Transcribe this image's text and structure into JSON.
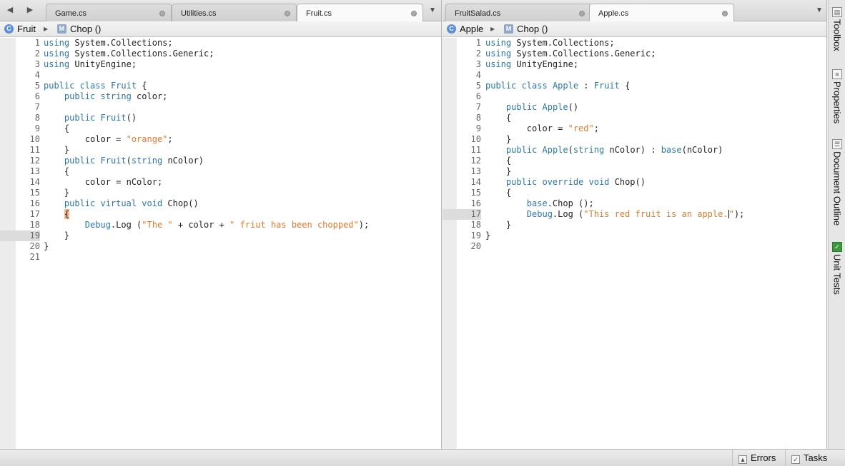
{
  "left": {
    "tabs": [
      {
        "label": "Game.cs",
        "active": false
      },
      {
        "label": "Utilities.cs",
        "active": false
      },
      {
        "label": "Fruit.cs",
        "active": true
      }
    ],
    "path": {
      "class_name": "Fruit",
      "method_name": "Chop ()"
    },
    "current_line": 19,
    "lines": [
      {
        "n": "1",
        "tokens": [
          {
            "t": "using",
            "c": "kw"
          },
          {
            "t": " System.Collections;"
          }
        ]
      },
      {
        "n": "2",
        "tokens": [
          {
            "t": "using",
            "c": "kw"
          },
          {
            "t": " System.Collections.Generic;"
          }
        ]
      },
      {
        "n": "3",
        "tokens": [
          {
            "t": "using",
            "c": "kw"
          },
          {
            "t": " UnityEngine;"
          }
        ]
      },
      {
        "n": "4",
        "tokens": []
      },
      {
        "n": "5",
        "tokens": [
          {
            "t": "public class",
            "c": "kw"
          },
          {
            "t": " "
          },
          {
            "t": "Fruit",
            "c": "ty"
          },
          {
            "t": " {"
          }
        ]
      },
      {
        "n": "6",
        "tokens": [
          {
            "t": "    "
          },
          {
            "t": "public string",
            "c": "kw"
          },
          {
            "t": " color;"
          }
        ]
      },
      {
        "n": "7",
        "tokens": []
      },
      {
        "n": "8",
        "tokens": [
          {
            "t": "    "
          },
          {
            "t": "public",
            "c": "kw"
          },
          {
            "t": " "
          },
          {
            "t": "Fruit",
            "c": "ty"
          },
          {
            "t": "()"
          }
        ]
      },
      {
        "n": "9",
        "tokens": [
          {
            "t": "    {"
          }
        ]
      },
      {
        "n": "10",
        "tokens": [
          {
            "t": "        color = "
          },
          {
            "t": "\"orange\"",
            "c": "str"
          },
          {
            "t": ";"
          }
        ]
      },
      {
        "n": "11",
        "tokens": [
          {
            "t": "    }"
          }
        ]
      },
      {
        "n": "12",
        "tokens": [
          {
            "t": "    "
          },
          {
            "t": "public",
            "c": "kw"
          },
          {
            "t": " "
          },
          {
            "t": "Fruit",
            "c": "ty"
          },
          {
            "t": "("
          },
          {
            "t": "string",
            "c": "kw"
          },
          {
            "t": " nColor)"
          }
        ]
      },
      {
        "n": "13",
        "tokens": [
          {
            "t": "    {"
          }
        ]
      },
      {
        "n": "14",
        "tokens": [
          {
            "t": "        color = nColor;"
          }
        ]
      },
      {
        "n": "15",
        "tokens": [
          {
            "t": "    }"
          }
        ]
      },
      {
        "n": "16",
        "tokens": [
          {
            "t": "    "
          },
          {
            "t": "public virtual void",
            "c": "kw"
          },
          {
            "t": " Chop()"
          }
        ]
      },
      {
        "n": "17",
        "tokens": [
          {
            "t": "    "
          },
          {
            "t": "{",
            "c": "bh"
          }
        ]
      },
      {
        "n": "18",
        "tokens": [
          {
            "t": "        "
          },
          {
            "t": "Debug",
            "c": "ty"
          },
          {
            "t": ".Log ("
          },
          {
            "t": "\"The \"",
            "c": "str"
          },
          {
            "t": " + color + "
          },
          {
            "t": "\" friut has been chopped\"",
            "c": "str"
          },
          {
            "t": ");"
          }
        ]
      },
      {
        "n": "19",
        "tokens": [
          {
            "t": "    }"
          }
        ]
      },
      {
        "n": "20",
        "tokens": [
          {
            "t": "}"
          }
        ]
      },
      {
        "n": "21",
        "tokens": []
      }
    ]
  },
  "right": {
    "tabs": [
      {
        "label": "FruitSalad.cs",
        "active": false
      },
      {
        "label": "Apple.cs",
        "active": true
      }
    ],
    "path": {
      "class_name": "Apple",
      "method_name": "Chop ()"
    },
    "current_line": 17,
    "lines": [
      {
        "n": "1",
        "tokens": [
          {
            "t": "using",
            "c": "kw"
          },
          {
            "t": " System.Collections;"
          }
        ]
      },
      {
        "n": "2",
        "tokens": [
          {
            "t": "using",
            "c": "kw"
          },
          {
            "t": " System.Collections.Generic;"
          }
        ]
      },
      {
        "n": "3",
        "tokens": [
          {
            "t": "using",
            "c": "kw"
          },
          {
            "t": " UnityEngine;"
          }
        ]
      },
      {
        "n": "4",
        "tokens": []
      },
      {
        "n": "5",
        "tokens": [
          {
            "t": "public class",
            "c": "kw"
          },
          {
            "t": " "
          },
          {
            "t": "Apple",
            "c": "ty"
          },
          {
            "t": " : "
          },
          {
            "t": "Fruit",
            "c": "ty"
          },
          {
            "t": " {"
          }
        ]
      },
      {
        "n": "6",
        "tokens": []
      },
      {
        "n": "7",
        "tokens": [
          {
            "t": "    "
          },
          {
            "t": "public",
            "c": "kw"
          },
          {
            "t": " "
          },
          {
            "t": "Apple",
            "c": "ty"
          },
          {
            "t": "()"
          }
        ]
      },
      {
        "n": "8",
        "tokens": [
          {
            "t": "    {"
          }
        ]
      },
      {
        "n": "9",
        "tokens": [
          {
            "t": "        color = "
          },
          {
            "t": "\"red\"",
            "c": "str"
          },
          {
            "t": ";"
          }
        ]
      },
      {
        "n": "10",
        "tokens": [
          {
            "t": "    }"
          }
        ]
      },
      {
        "n": "11",
        "tokens": [
          {
            "t": "    "
          },
          {
            "t": "public",
            "c": "kw"
          },
          {
            "t": " "
          },
          {
            "t": "Apple",
            "c": "ty"
          },
          {
            "t": "("
          },
          {
            "t": "string",
            "c": "kw"
          },
          {
            "t": " nColor) : "
          },
          {
            "t": "base",
            "c": "kw"
          },
          {
            "t": "(nColor)"
          }
        ]
      },
      {
        "n": "12",
        "tokens": [
          {
            "t": "    {"
          }
        ]
      },
      {
        "n": "13",
        "tokens": [
          {
            "t": "    }"
          }
        ]
      },
      {
        "n": "14",
        "tokens": [
          {
            "t": "    "
          },
          {
            "t": "public override void",
            "c": "kw"
          },
          {
            "t": " Chop()"
          }
        ]
      },
      {
        "n": "15",
        "tokens": [
          {
            "t": "    {"
          }
        ]
      },
      {
        "n": "16",
        "tokens": [
          {
            "t": "        "
          },
          {
            "t": "base",
            "c": "kw"
          },
          {
            "t": ".Chop ();"
          }
        ]
      },
      {
        "n": "17",
        "tokens": [
          {
            "t": "        "
          },
          {
            "t": "Debug",
            "c": "ty"
          },
          {
            "t": ".Log ("
          },
          {
            "t": "\"This red fruit is an apple.",
            "c": "str"
          },
          {
            "t": "",
            "c": "caret"
          },
          {
            "t": "\"",
            "c": "str"
          },
          {
            "t": ");"
          }
        ]
      },
      {
        "n": "18",
        "tokens": [
          {
            "t": "    }"
          }
        ]
      },
      {
        "n": "19",
        "tokens": [
          {
            "t": "}"
          }
        ]
      },
      {
        "n": "20",
        "tokens": []
      }
    ]
  },
  "side_panel": {
    "tabs": [
      {
        "label": "Toolbox",
        "icon": "toolbox-icon"
      },
      {
        "label": "Properties",
        "icon": "properties-icon"
      },
      {
        "label": "Document Outline",
        "icon": "document-outline-icon"
      },
      {
        "label": "Unit Tests",
        "icon": "unit-tests-icon"
      }
    ]
  },
  "status_bar": {
    "errors_label": "Errors",
    "tasks_label": "Tasks"
  },
  "colors": {
    "keyword": "#2b79a8",
    "string": "#e5782c",
    "brace_highlight": "#f4b48c"
  }
}
